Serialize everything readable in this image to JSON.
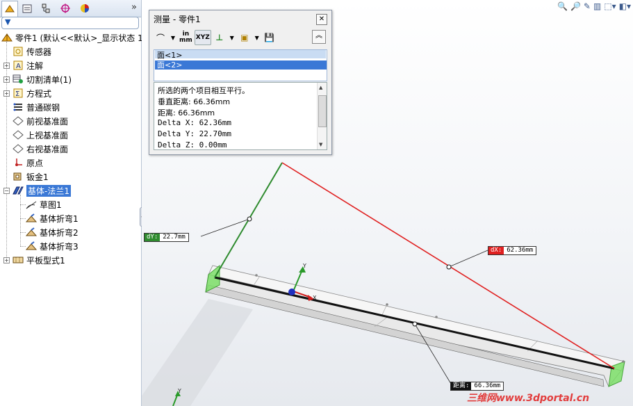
{
  "feature_tree": {
    "filter_icon": "funnel-icon",
    "items": [
      {
        "label": "零件1 (默认<<默认>_显示状态 1",
        "icon": "part-icon"
      },
      {
        "label": "传感器",
        "icon": "sensor-icon"
      },
      {
        "label": "注解",
        "icon": "annotation-icon"
      },
      {
        "label": "切割清单(1)",
        "icon": "cutlist-icon"
      },
      {
        "label": "方程式",
        "icon": "equation-icon"
      },
      {
        "label": "普通碳钢",
        "icon": "material-icon"
      },
      {
        "label": "前视基准面",
        "icon": "plane-icon"
      },
      {
        "label": "上视基准面",
        "icon": "plane-icon"
      },
      {
        "label": "右视基准面",
        "icon": "plane-icon"
      },
      {
        "label": "原点",
        "icon": "origin-icon"
      },
      {
        "label": "钣金1",
        "icon": "sheetmetal-icon"
      },
      {
        "label": "基体-法兰1",
        "icon": "base-flange-icon"
      },
      {
        "label": "草图1",
        "icon": "sketch-icon"
      },
      {
        "label": "基体折弯1",
        "icon": "bend-icon"
      },
      {
        "label": "基体折弯2",
        "icon": "bend-icon"
      },
      {
        "label": "基体折弯3",
        "icon": "bend-icon"
      },
      {
        "label": "平板型式1",
        "icon": "flat-pattern-icon"
      }
    ],
    "selected_index": 11
  },
  "measure": {
    "title": "测量 - 零件1",
    "selections": [
      "面<1>",
      "面<2>"
    ],
    "highlighted_selection": 1,
    "results": [
      "所选的两个项目相互平行。",
      "垂直距离: 66.36mm",
      "距离: 66.36mm",
      "Delta X: 62.36mm",
      "Delta Y: 22.70mm",
      "Delta Z: 0.00mm"
    ],
    "units_label_top": "in",
    "units_label_bottom": "mm",
    "xyz_label": "XYZ"
  },
  "callouts": {
    "dy": {
      "tag": "dY:",
      "value": "22.7mm"
    },
    "dx": {
      "tag": "dX:",
      "value": "62.36mm"
    },
    "dist": {
      "tag": "距离:",
      "value": "66.36mm"
    }
  },
  "triad": {
    "x": "X",
    "y": "Y"
  },
  "watermark": "三维网www.3dportal.cn",
  "colors": {
    "selection_blue": "#3a78d6",
    "dx_red": "#e02020",
    "dy_green": "#2e8b2e",
    "measure_black": "#111111"
  }
}
